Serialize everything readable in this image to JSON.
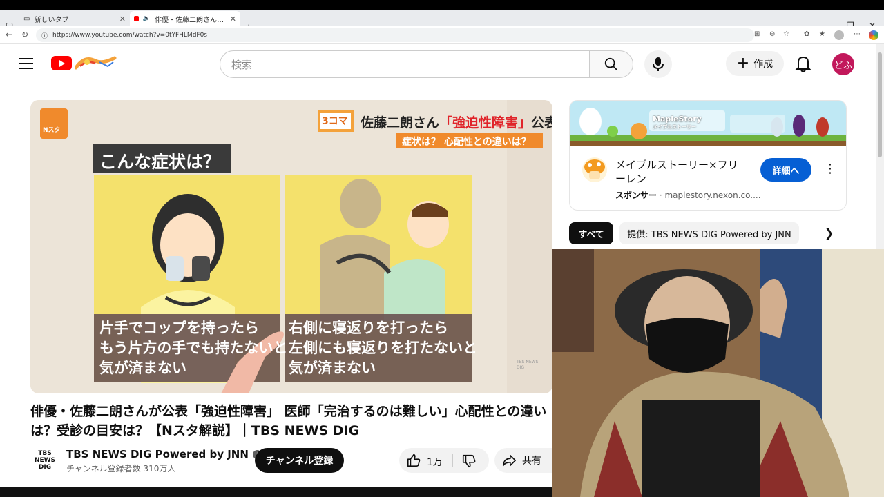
{
  "browser": {
    "tabs": [
      {
        "label": "新しいタブ",
        "active": false
      },
      {
        "label": "俳優・佐藤二朗さんが公表「強迫",
        "active": true
      }
    ],
    "url": "https://www.youtube.com/watch?v=0tYFHLMdF0s",
    "new_tab_symbol": "+"
  },
  "header": {
    "search_placeholder": "検索",
    "create_label": "作成",
    "avatar_text": "どふ"
  },
  "video": {
    "title": "俳優・佐藤二朗さんが公表「強迫性障害」 医師「完治するのは難しい」心配性との違いは？受診の目安は？【Nスタ解説】｜TBS NEWS DIG",
    "frame": {
      "badge": "3コマ",
      "headline_a": "佐藤二朗さん",
      "headline_b": "「強迫性障害」",
      "headline_c": "公表",
      "subheadline": "症状は？ 心配性との違いは？",
      "question": "こんな症状は？",
      "caption_left": "片手でコップを持ったら\nもう片方の手でも持たないと\n気が済まない",
      "caption_right": "右側に寝返りを打ったら\n左側にも寝返りを打たないと\n気が済まない",
      "logo_text": "Nスタ",
      "watermark": "TBS NEWS DIG"
    }
  },
  "channel": {
    "name": "TBS NEWS DIG Powered by JNN",
    "subscribers": "チャンネル登録者数 310万人",
    "logo_lines": [
      "TBS",
      "NEWS",
      "DIG"
    ],
    "subscribe_label": "チャンネル登録",
    "like_count": "1万",
    "share_label": "共有"
  },
  "ad": {
    "title": "メイプルストーリー×フリーレン",
    "sponsor_label": "スポンサー",
    "sponsor_domain": "maplestory.nexon.co....",
    "cta": "詳細へ",
    "banner_text_1": "MapleStory",
    "banner_text_2": "メイプルストーリー"
  },
  "chips": {
    "all": "すべて",
    "provider": "提供: TBS NEWS DIG Powered by JNN"
  },
  "colors": {
    "yt_red": "#ff0000",
    "subscribe_bg": "#0f0f0f",
    "cta_blue": "#065fd4",
    "avatar_bg": "#c2185b"
  }
}
